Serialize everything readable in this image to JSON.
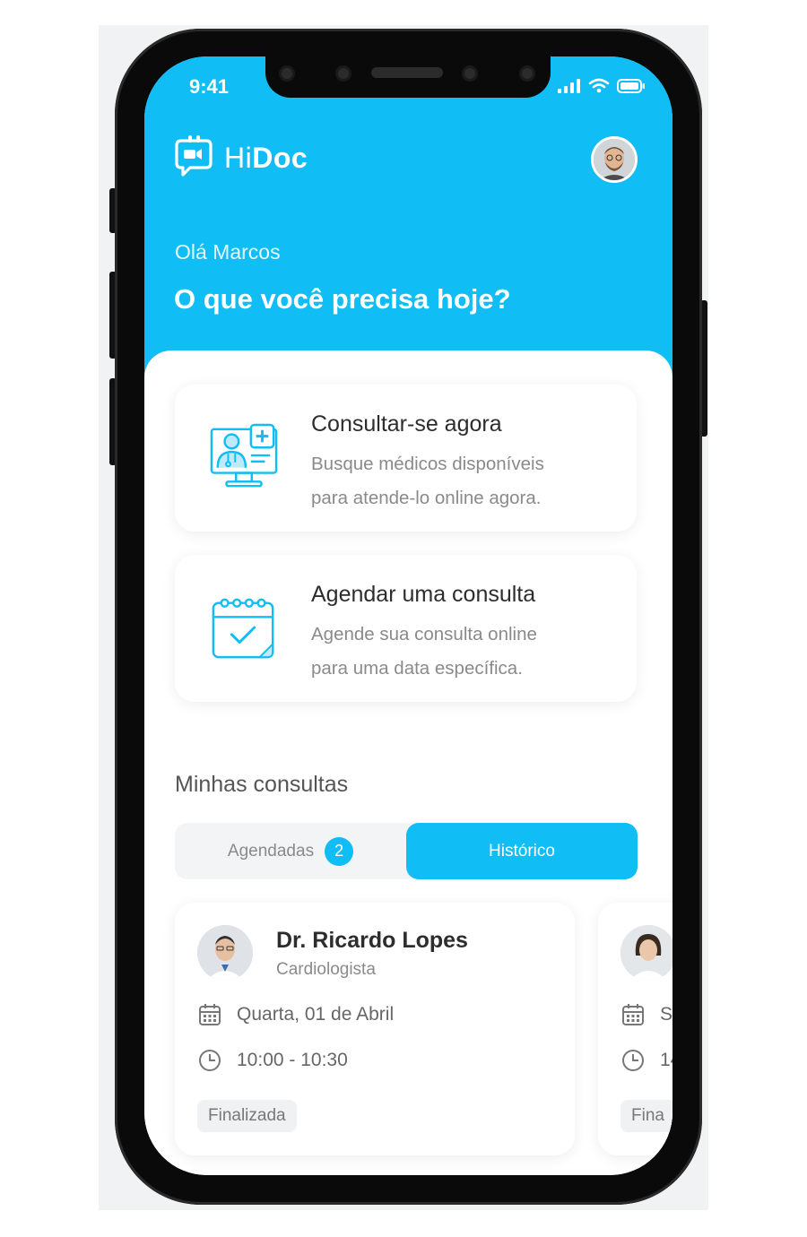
{
  "status_bar": {
    "time": "9:41"
  },
  "app": {
    "logo_light": "Hi",
    "logo_bold": "Doc"
  },
  "header": {
    "greeting": "Olá Marcos",
    "question": "O que você precisa hoje?"
  },
  "actions": [
    {
      "title": "Consultar-se agora",
      "desc_line1": "Busque médicos disponíveis",
      "desc_line2": "para atende-lo online agora.",
      "icon": "doctor-monitor-icon"
    },
    {
      "title": "Agendar uma consulta",
      "desc_line1": "Agende sua consulta online",
      "desc_line2": "para uma data específica.",
      "icon": "calendar-check-icon"
    }
  ],
  "section": {
    "title": "Minhas consultas"
  },
  "tabs": {
    "scheduled_label": "Agendadas",
    "scheduled_count": "2",
    "history_label": "Histórico"
  },
  "appointments": [
    {
      "doctor": "Dr. Ricardo Lopes",
      "specialty": "Cardiologista",
      "date": "Quarta, 01 de Abril",
      "time": "10:00 - 10:30",
      "status": "Finalizada"
    },
    {
      "doctor": "",
      "specialty": "",
      "date": "S",
      "time": "14",
      "status": "Fina"
    }
  ],
  "colors": {
    "accent": "#10bdf4",
    "text_dark": "#2d2d2d",
    "text_muted": "#8a8a8a"
  }
}
